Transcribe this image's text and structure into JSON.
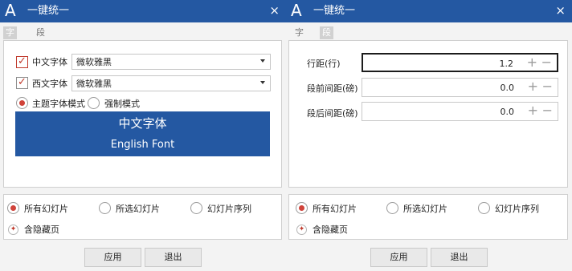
{
  "window": {
    "app_icon": "A",
    "title": "一键统一",
    "close_icon": "×"
  },
  "tabs": [
    {
      "label": "字体"
    },
    {
      "label": "段落"
    }
  ],
  "font_panel": {
    "cn_font": {
      "label": "中文字体",
      "value": "微软雅黑",
      "checked": true
    },
    "west_font": {
      "label": "西文字体",
      "value": "微软雅黑",
      "checked": true
    },
    "mode_theme": {
      "label": "主题字体模式",
      "selected": true
    },
    "mode_force": {
      "label": "强制模式",
      "selected": false
    },
    "preview": {
      "cn": "中文字体",
      "en": "English Font"
    }
  },
  "para_panel": {
    "fields": [
      {
        "label": "行距(行)",
        "value": "1.2"
      },
      {
        "label": "段前间距(磅)",
        "value": "0.0"
      },
      {
        "label": "段后间距(磅)",
        "value": "0.0"
      }
    ]
  },
  "scope": {
    "all": "所有幻灯片",
    "selected": "所选幻灯片",
    "sequence": "幻灯片序列",
    "include_hidden": "含隐藏页"
  },
  "buttons": {
    "apply": "应用",
    "exit": "退出"
  },
  "icons": {
    "plus": "+",
    "minus": "−",
    "check": "✓",
    "pin": "✦"
  },
  "colors": {
    "accent": "#2458a2",
    "highlight": "#c0392b"
  }
}
